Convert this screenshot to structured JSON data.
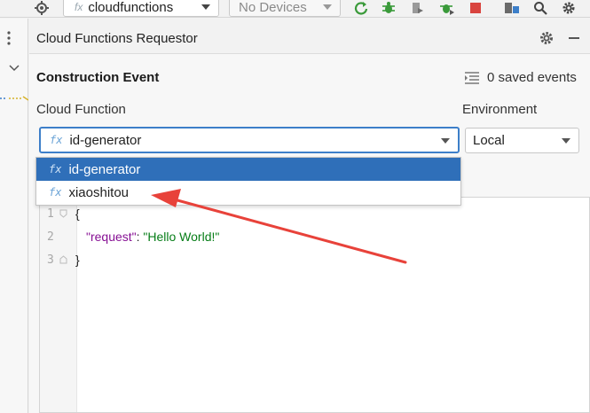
{
  "toolbar": {
    "config_fx": "fx",
    "config_name": "cloudfunctions",
    "devices": "No Devices"
  },
  "panel": {
    "title": "Cloud Functions Requestor",
    "section_title": "Construction Event",
    "saved_events": "0 saved events",
    "cloud_function_label": "Cloud Function",
    "environment_label": "Environment",
    "selected_function": "id-generator",
    "environment_value": "Local",
    "fx": "fx"
  },
  "dropdown": {
    "items": [
      {
        "label": "id-generator",
        "selected": true
      },
      {
        "label": "xiaoshitou",
        "selected": false
      }
    ]
  },
  "editor": {
    "line_numbers": [
      "1",
      "2",
      "3"
    ],
    "line1": "{",
    "line2_key": "\"request\"",
    "line2_colon": ": ",
    "line2_value": "\"Hello World!\"",
    "line3": "}"
  },
  "colors": {
    "accent_blue": "#2f6fb9",
    "focus_border": "#3d7fc9",
    "annotation_red": "#e8423a",
    "json_key": "#871094",
    "json_string": "#067d17"
  },
  "icons": [
    "target-icon",
    "run-icon",
    "debug-icon",
    "coverage-icon",
    "profile-icon",
    "stop-icon",
    "structure-icon",
    "search-icon",
    "settings-icon"
  ]
}
